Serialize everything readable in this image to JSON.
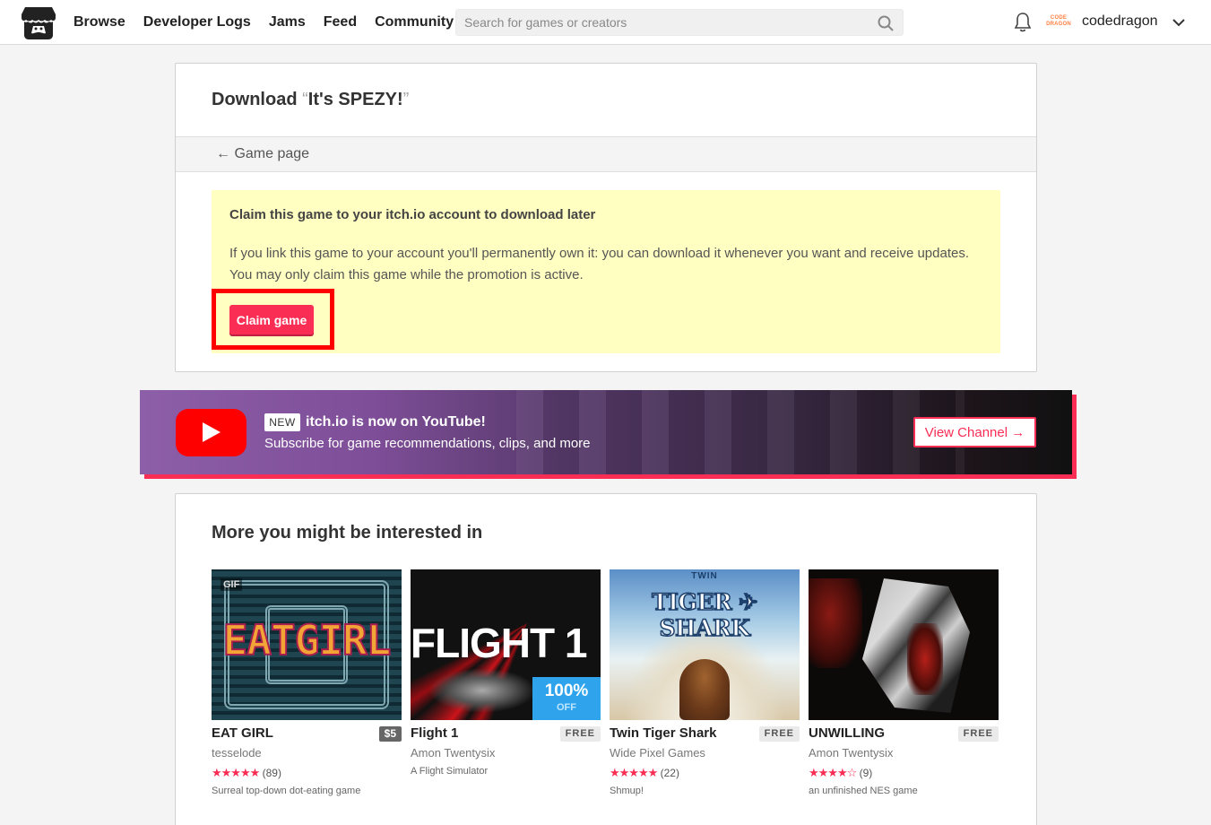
{
  "header": {
    "nav": [
      "Browse",
      "Developer Logs",
      "Jams",
      "Feed",
      "Community"
    ],
    "search_placeholder": "Search for games or creators",
    "avatar_text": [
      "CODE",
      "DRAGON"
    ],
    "username": "codedragon"
  },
  "download": {
    "title_prefix": "Download ",
    "open_quote": "“",
    "game_name": "It's SPEZY!",
    "close_quote": "”",
    "back_label": "← Game page",
    "notice_heading": "Claim this game to your itch.io account to download later",
    "notice_body": "If you link this game to your account you'll permanently own it: you can download it whenever you want and receive updates. You may only claim this game while the promotion is active.",
    "claim_label": "Claim game"
  },
  "youtube": {
    "badge": "NEW",
    "title": "itch.io is now on YouTube!",
    "subtitle": "Subscribe for game recommendations, clips, and more",
    "button": "View Channel →"
  },
  "recommendations": {
    "heading": "More you might be interested in",
    "games": [
      {
        "title": "EAT GIRL",
        "price": "$5",
        "author": "tesselode",
        "stars": "★★★★★",
        "count": "(89)",
        "short": "Surreal top-down dot-eating game",
        "thumb_badge": "GIF",
        "thumb_text": "EATGIRL"
      },
      {
        "title": "Flight 1",
        "price": "FREE",
        "author": "Amon Twentysix",
        "stars": "",
        "count": "",
        "short": "A Flight Simulator",
        "thumb_text": "FLIGHT 1",
        "sale_pct": "100%",
        "sale_off": "OFF"
      },
      {
        "title": "Twin Tiger Shark",
        "price": "FREE",
        "author": "Wide Pixel Games",
        "stars": "★★★★★",
        "count": "(22)",
        "short": "Shmup!",
        "thumb_twin": "TWIN",
        "thumb_text": "TIGER ✈ SHARK"
      },
      {
        "title": "UNWILLING",
        "price": "FREE",
        "author": "Amon Twentysix",
        "stars": "★★★★☆",
        "count": "(9)",
        "short": "an unfinished NES game"
      }
    ]
  },
  "colors": {
    "accent": "#fa2d54",
    "notice_bg": "#ffffc1",
    "highlight": "#ff0000",
    "sale_blue": "#2fa4ed"
  }
}
